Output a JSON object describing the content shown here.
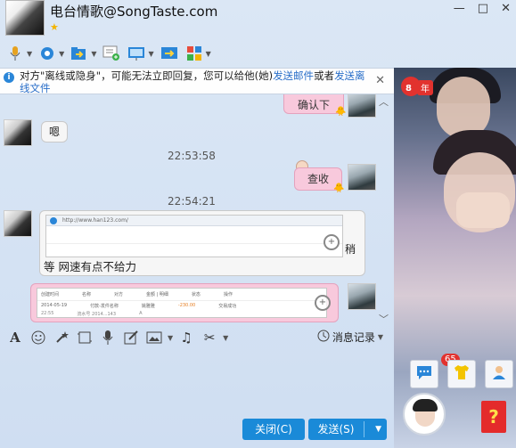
{
  "header": {
    "title": "电台情歌@SongTaste.com",
    "star": "★",
    "window_buttons": [
      "—",
      "□",
      "✕"
    ]
  },
  "toolbar": {
    "items": [
      {
        "name": "voice-call-icon",
        "glyph": "🎙"
      },
      {
        "name": "video-call-icon",
        "glyph": "📹"
      },
      {
        "name": "send-file-icon",
        "glyph": "📁"
      },
      {
        "name": "create-group-icon",
        "glyph": "💬"
      },
      {
        "name": "remote-desktop-icon",
        "glyph": "🖥"
      },
      {
        "name": "share-screen-icon",
        "glyph": "⇆"
      },
      {
        "name": "apps-icon",
        "glyph": "▦"
      }
    ]
  },
  "info_bar": {
    "text_before": "对方\"离线或隐身\"，可能无法立即回复，您可以给他(她)",
    "link1": "发送邮件",
    "text_middle": "或者",
    "link2": "发送离线文件",
    "close": "✕"
  },
  "chat": {
    "msg_top_partial": "确认下",
    "msg_left_1": "嗯",
    "timestamp_1": "22:53:58",
    "msg_right_1": "查收",
    "timestamp_2": "22:54:21",
    "msg_left_2_tail": "稍",
    "msg_left_2_text": "等  网速有点不给力",
    "screenshot_url": "http://www.han123.com/",
    "table_headers": [
      "创建时间",
      "名称",
      "对方",
      "金额 | 明细",
      "状态",
      "操作"
    ],
    "table_row_1": [
      "2014-05-19",
      "付款-发件名称",
      "姚雅雅",
      "-230.00",
      "交易成功"
    ],
    "table_row_2": [
      "22:55",
      "流水号 2014...143",
      "A",
      "",
      ""
    ]
  },
  "input_toolbar": {
    "icons": [
      "font-icon",
      "emoji-icon",
      "magic-icon",
      "screenshot-icon",
      "voice-message-icon",
      "doodle-icon",
      "image-icon",
      "music-icon",
      "cut-icon"
    ],
    "history_label": "消息记录"
  },
  "buttons": {
    "close": "关闭(C)",
    "send": "发送(S)"
  },
  "right_panel": {
    "years_badge_num": "8",
    "years_badge_label": "年",
    "notification_count": "65",
    "help_glyph": "?"
  },
  "colors": {
    "accent_blue": "#1a8ad8",
    "pink_bubble": "#f8c9dc",
    "link_blue": "#2a6fc9",
    "badge_red": "#e2322e"
  }
}
